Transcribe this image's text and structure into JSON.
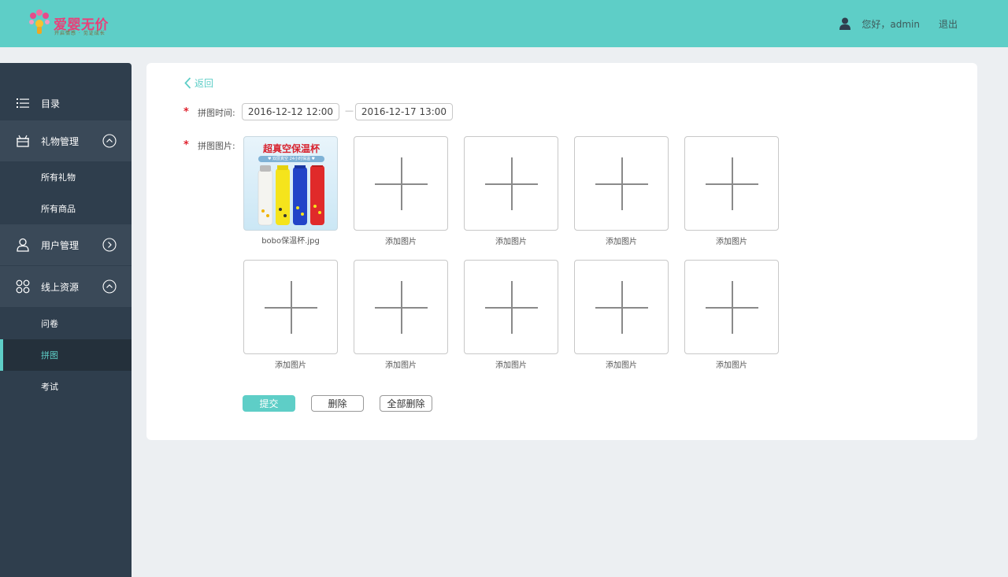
{
  "header": {
    "logo_text": "爱婴无价",
    "logo_sub": "开启情感 · 见证成长",
    "greeting": "您好，admin",
    "logout": "退出"
  },
  "sidebar": {
    "catalog": "目录",
    "groups": [
      {
        "label": "礼物管理",
        "expanded": true,
        "items": [
          "所有礼物",
          "所有商品"
        ]
      },
      {
        "label": "用户管理",
        "expanded": false,
        "items": []
      },
      {
        "label": "线上资源",
        "expanded": true,
        "items": [
          "问卷",
          "拼图",
          "考试"
        ]
      }
    ],
    "active_item": "拼图"
  },
  "main": {
    "back": "返回",
    "time_label": "拼图时间:",
    "start_time": "2016-12-12 12:00",
    "end_time": "2016-12-17 13:00",
    "time_sep": "—",
    "image_label": "拼图图片:",
    "uploaded": {
      "filename": "bobo保温杯.jpg",
      "preview_title": "超真空保温杯",
      "preview_sub": "♥ 双层真空 24小时保温 ♥"
    },
    "add_caption": "添加图片",
    "buttons": {
      "submit": "提交",
      "delete": "删除",
      "delete_all": "全部删除"
    }
  },
  "colors": {
    "accent": "#5ecec7",
    "sidebar_bg": "#2f3e4d",
    "required": "#e0222e"
  }
}
